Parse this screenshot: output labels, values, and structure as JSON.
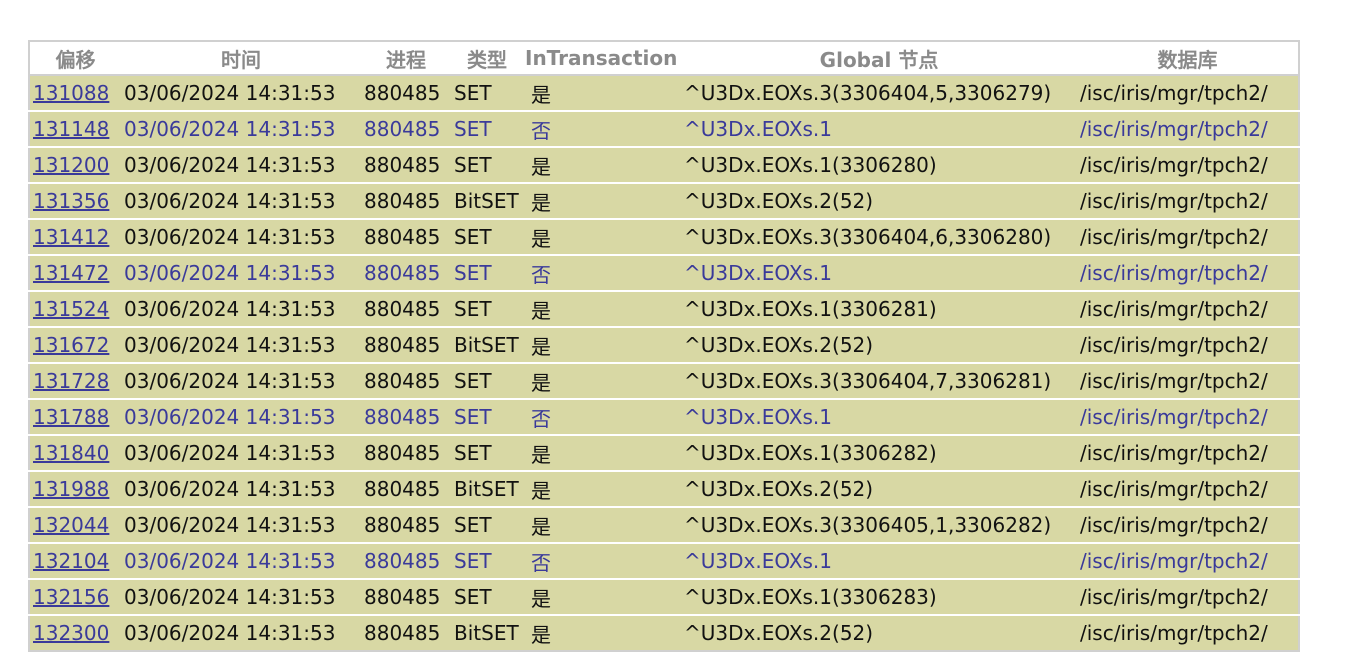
{
  "headers": {
    "offset": "偏移",
    "time": "时间",
    "process": "进程",
    "type": "类型",
    "in_transaction": "InTransaction",
    "global_node": "Global 节点",
    "database": "数据库"
  },
  "rows": [
    {
      "offset": "131088",
      "time": "03/06/2024 14:31:53",
      "process": "880485",
      "type": "SET",
      "in_transaction": "是",
      "global_node": "^U3Dx.EOXs.3(3306404,5,3306279)",
      "database": "/isc/iris/mgr/tpch2/"
    },
    {
      "offset": "131148",
      "time": "03/06/2024 14:31:53",
      "process": "880485",
      "type": "SET",
      "in_transaction": "否",
      "global_node": "^U3Dx.EOXs.1",
      "database": "/isc/iris/mgr/tpch2/"
    },
    {
      "offset": "131200",
      "time": "03/06/2024 14:31:53",
      "process": "880485",
      "type": "SET",
      "in_transaction": "是",
      "global_node": "^U3Dx.EOXs.1(3306280)",
      "database": "/isc/iris/mgr/tpch2/"
    },
    {
      "offset": "131356",
      "time": "03/06/2024 14:31:53",
      "process": "880485",
      "type": "BitSET",
      "in_transaction": "是",
      "global_node": "^U3Dx.EOXs.2(52)",
      "database": "/isc/iris/mgr/tpch2/"
    },
    {
      "offset": "131412",
      "time": "03/06/2024 14:31:53",
      "process": "880485",
      "type": "SET",
      "in_transaction": "是",
      "global_node": "^U3Dx.EOXs.3(3306404,6,3306280)",
      "database": "/isc/iris/mgr/tpch2/"
    },
    {
      "offset": "131472",
      "time": "03/06/2024 14:31:53",
      "process": "880485",
      "type": "SET",
      "in_transaction": "否",
      "global_node": "^U3Dx.EOXs.1",
      "database": "/isc/iris/mgr/tpch2/"
    },
    {
      "offset": "131524",
      "time": "03/06/2024 14:31:53",
      "process": "880485",
      "type": "SET",
      "in_transaction": "是",
      "global_node": "^U3Dx.EOXs.1(3306281)",
      "database": "/isc/iris/mgr/tpch2/"
    },
    {
      "offset": "131672",
      "time": "03/06/2024 14:31:53",
      "process": "880485",
      "type": "BitSET",
      "in_transaction": "是",
      "global_node": "^U3Dx.EOXs.2(52)",
      "database": "/isc/iris/mgr/tpch2/"
    },
    {
      "offset": "131728",
      "time": "03/06/2024 14:31:53",
      "process": "880485",
      "type": "SET",
      "in_transaction": "是",
      "global_node": "^U3Dx.EOXs.3(3306404,7,3306281)",
      "database": "/isc/iris/mgr/tpch2/"
    },
    {
      "offset": "131788",
      "time": "03/06/2024 14:31:53",
      "process": "880485",
      "type": "SET",
      "in_transaction": "否",
      "global_node": "^U3Dx.EOXs.1",
      "database": "/isc/iris/mgr/tpch2/"
    },
    {
      "offset": "131840",
      "time": "03/06/2024 14:31:53",
      "process": "880485",
      "type": "SET",
      "in_transaction": "是",
      "global_node": "^U3Dx.EOXs.1(3306282)",
      "database": "/isc/iris/mgr/tpch2/"
    },
    {
      "offset": "131988",
      "time": "03/06/2024 14:31:53",
      "process": "880485",
      "type": "BitSET",
      "in_transaction": "是",
      "global_node": "^U3Dx.EOXs.2(52)",
      "database": "/isc/iris/mgr/tpch2/"
    },
    {
      "offset": "132044",
      "time": "03/06/2024 14:31:53",
      "process": "880485",
      "type": "SET",
      "in_transaction": "是",
      "global_node": "^U3Dx.EOXs.3(3306405,1,3306282)",
      "database": "/isc/iris/mgr/tpch2/"
    },
    {
      "offset": "132104",
      "time": "03/06/2024 14:31:53",
      "process": "880485",
      "type": "SET",
      "in_transaction": "否",
      "global_node": "^U3Dx.EOXs.1",
      "database": "/isc/iris/mgr/tpch2/"
    },
    {
      "offset": "132156",
      "time": "03/06/2024 14:31:53",
      "process": "880485",
      "type": "SET",
      "in_transaction": "是",
      "global_node": "^U3Dx.EOXs.1(3306283)",
      "database": "/isc/iris/mgr/tpch2/"
    },
    {
      "offset": "132300",
      "time": "03/06/2024 14:31:53",
      "process": "880485",
      "type": "BitSET",
      "in_transaction": "是",
      "global_node": "^U3Dx.EOXs.2(52)",
      "database": "/isc/iris/mgr/tpch2/"
    }
  ],
  "colors": {
    "row_background": "#d8d8a4",
    "header_text": "#8a8a8a",
    "link": "#3a3a9a",
    "non_transaction_text": "#3a3a9a"
  }
}
